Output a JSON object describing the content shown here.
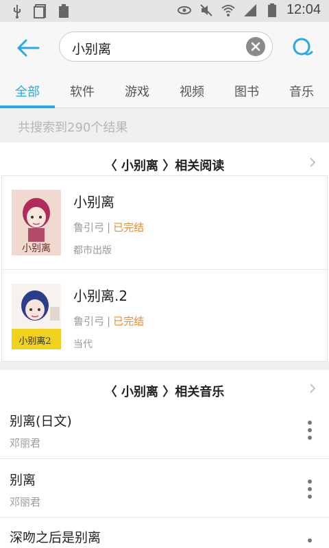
{
  "status_bar": {
    "time": "12:04",
    "icons": [
      "usb-icon",
      "sim-icon",
      "battery-small-icon",
      "eye-icon",
      "mute-icon",
      "wifi-icon",
      "signal-icon",
      "battery-icon"
    ]
  },
  "header": {
    "back_icon": "arrow-left-icon",
    "search_value": "小别离",
    "clear_icon": "clear-icon",
    "search_icon": "search-icon"
  },
  "tabs": [
    {
      "label": "全部",
      "active": true
    },
    {
      "label": "软件",
      "active": false
    },
    {
      "label": "游戏",
      "active": false
    },
    {
      "label": "视频",
      "active": false
    },
    {
      "label": "图书",
      "active": false
    },
    {
      "label": "音乐",
      "active": false
    }
  ],
  "result_count": "共搜索到290个结果",
  "reading_section": {
    "title": "〈 小别离 〉相关阅读",
    "books": [
      {
        "title": "小别离",
        "author": "鲁引弓",
        "sep": "|",
        "status": "已完结",
        "publisher": "都市出版"
      },
      {
        "title": "小别离.2",
        "author": "鲁引弓",
        "sep": "|",
        "status": "已完结",
        "publisher": "当代"
      }
    ]
  },
  "music_section": {
    "title": "〈 小别离 〉相关音乐",
    "songs": [
      {
        "title": "别离(日文)",
        "artist": "邓丽君"
      },
      {
        "title": "别离",
        "artist": "邓丽君"
      },
      {
        "title": "深吻之后是别离",
        "artist": ""
      }
    ]
  },
  "colors": {
    "accent": "#27a9e3",
    "status_orange": "#f08a2c",
    "muted_text": "#9a9a9a"
  }
}
